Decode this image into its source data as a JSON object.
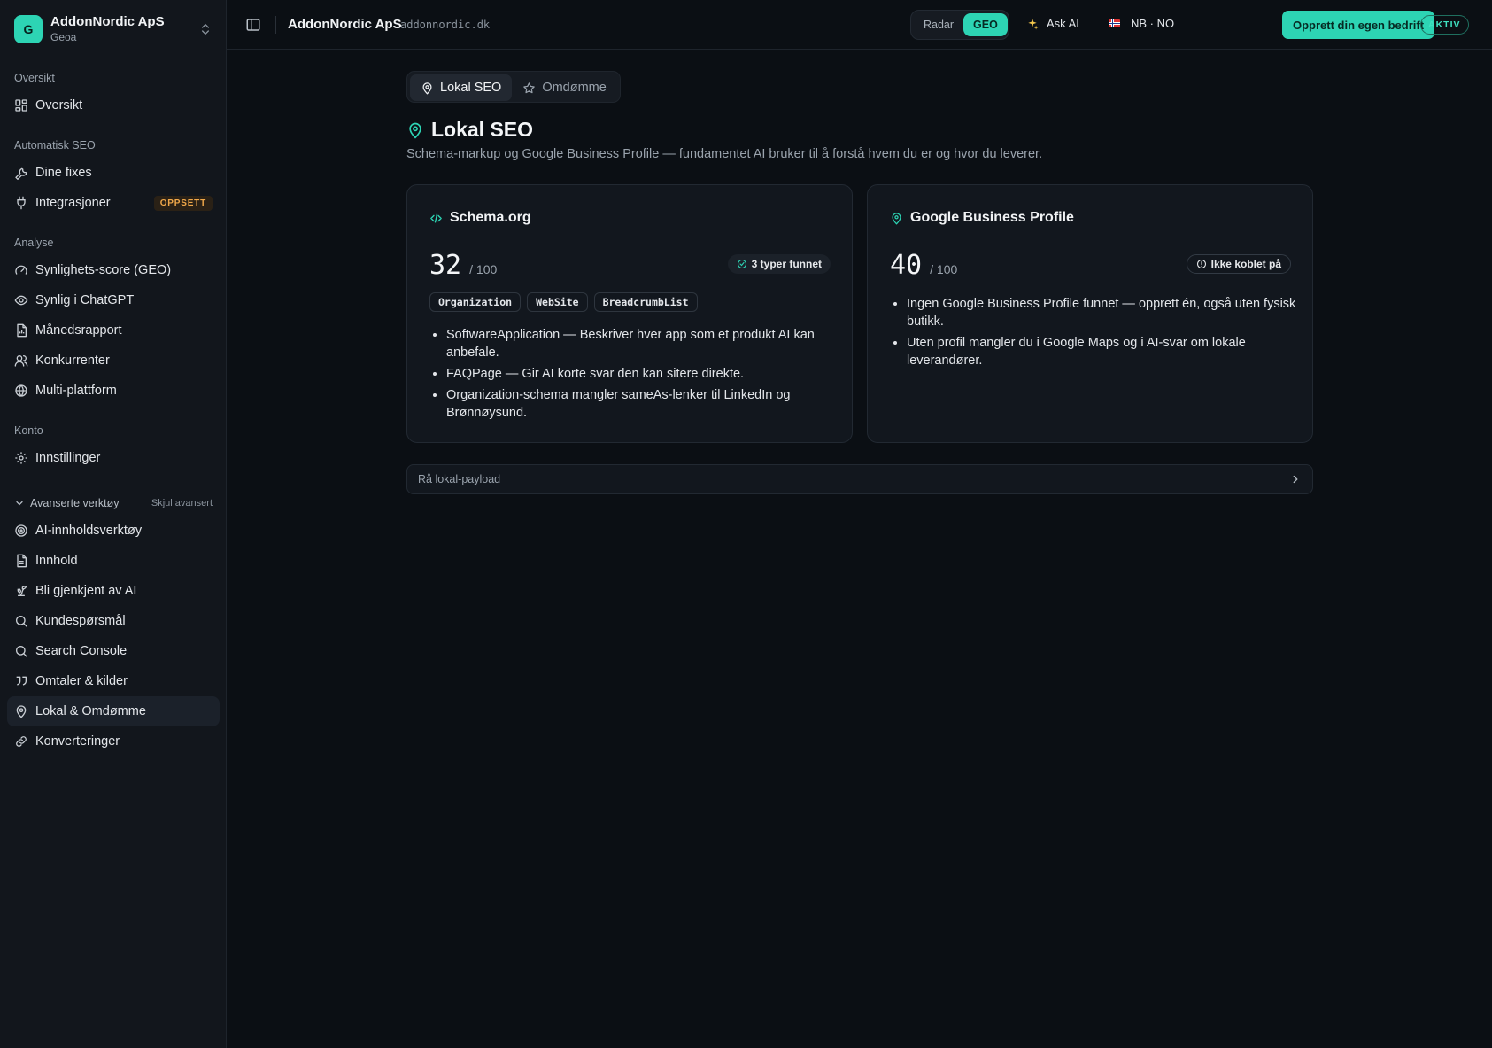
{
  "brand": {
    "logo_letter": "G",
    "name": "AddonNordic ApS",
    "sub": "Geoa"
  },
  "sidebar": {
    "sections": [
      {
        "title": "Oversikt",
        "items": [
          {
            "label": "Oversikt",
            "icon": "dashboard-icon"
          }
        ]
      },
      {
        "title": "Automatisk SEO",
        "items": [
          {
            "label": "Dine fixes",
            "icon": "wrench-icon"
          },
          {
            "label": "Integrasjoner",
            "icon": "plug-icon",
            "badge": "OPPSETT"
          }
        ]
      },
      {
        "title": "Analyse",
        "items": [
          {
            "label": "Synlighets-score (GEO)",
            "icon": "gauge-icon"
          },
          {
            "label": "Synlig i ChatGPT",
            "icon": "eye-icon"
          },
          {
            "label": "Månedsrapport",
            "icon": "file-chart-icon"
          },
          {
            "label": "Konkurrenter",
            "icon": "users-icon"
          },
          {
            "label": "Multi-plattform",
            "icon": "globe-icon"
          }
        ]
      },
      {
        "title": "Konto",
        "items": [
          {
            "label": "Innstillinger",
            "icon": "gear-icon"
          }
        ]
      }
    ],
    "advanced": {
      "title": "Avanserte verktøy",
      "hide_label": "Skjul avansert",
      "items": [
        {
          "label": "AI-innholdsverktøy",
          "icon": "target-icon"
        },
        {
          "label": "Innhold",
          "icon": "document-icon"
        },
        {
          "label": "Bli gjenkjent av AI",
          "icon": "sprout-icon"
        },
        {
          "label": "Kundespørsmål",
          "icon": "search-icon"
        },
        {
          "label": "Search Console",
          "icon": "search-icon"
        },
        {
          "label": "Omtaler & kilder",
          "icon": "quote-icon"
        },
        {
          "label": "Lokal & Omdømme",
          "icon": "map-pin-icon",
          "active": true
        },
        {
          "label": "Konverteringer",
          "icon": "link-icon"
        }
      ]
    }
  },
  "topbar": {
    "title": "AddonNordic ApS",
    "domain": "addonnordic.dk",
    "toggle": [
      {
        "label": "Radar"
      },
      {
        "label": "GEO",
        "active": true
      }
    ],
    "ask_ai": "Ask AI",
    "lang": "NB · NO",
    "cta": "Opprett din egen bedrift",
    "status": "AKTIV"
  },
  "main": {
    "tabs": [
      {
        "label": "Lokal SEO",
        "active": true
      },
      {
        "label": "Omdømme"
      }
    ],
    "title": "Lokal SEO",
    "subtitle": "Schema-markup og Google Business Profile — fundamentet AI bruker til å forstå hvem du er og hvor du leverer.",
    "cards": [
      {
        "title": "Schema.org",
        "score": "32",
        "max": "/ 100",
        "status": "3 typer funnet",
        "chips": [
          "Organization",
          "WebSite",
          "BreadcrumbList"
        ],
        "bullets": [
          "SoftwareApplication — Beskriver hver app som et produkt AI kan anbefale.",
          "FAQPage — Gir AI korte svar den kan sitere direkte.",
          "Organization-schema mangler sameAs-lenker til LinkedIn og Brønnøysund."
        ]
      },
      {
        "title": "Google Business Profile",
        "score": "40",
        "max": "/ 100",
        "status": "Ikke koblet på",
        "bullets": [
          "Ingen Google Business Profile funnet — opprett én, også uten fysisk butikk.",
          "Uten profil mangler du i Google Maps og i AI-svar om lokale leverandører."
        ]
      }
    ],
    "payload_label": "Rå lokal-payload"
  }
}
